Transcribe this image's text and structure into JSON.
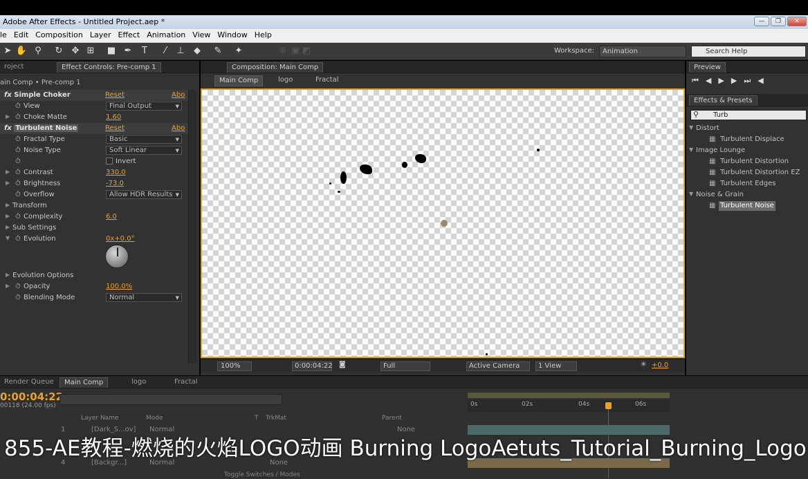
{
  "window": {
    "title": "Adobe After Effects - Untitled Project.aep *",
    "buttons": [
      "—",
      "❐",
      "✕"
    ]
  },
  "menu": [
    "le",
    "Edit",
    "Composition",
    "Layer",
    "Effect",
    "Animation",
    "View",
    "Window",
    "Help"
  ],
  "toolbar": {
    "workspace_label": "Workspace:",
    "workspace_value": "Animation",
    "search_help": "Search Help"
  },
  "left_panel": {
    "tabs": [
      "roject",
      "Effect Controls: Pre-comp 1"
    ],
    "breadcrumb": "ain Comp • Pre-comp 1",
    "effects": [
      {
        "kind": "head",
        "label": "Simple Choker",
        "reset": "Reset",
        "about": "Abo"
      },
      {
        "kind": "drop",
        "label": "View",
        "value": "Final Output"
      },
      {
        "kind": "val",
        "label": "Choke Matte",
        "value": "1.60"
      },
      {
        "kind": "head",
        "label": "Turbulent Noise",
        "reset": "Reset",
        "about": "Abo"
      },
      {
        "kind": "drop",
        "label": "Fractal Type",
        "value": "Basic"
      },
      {
        "kind": "drop",
        "label": "Noise Type",
        "value": "Soft Linear"
      },
      {
        "kind": "check",
        "label": "",
        "value": "Invert"
      },
      {
        "kind": "val",
        "label": "Contrast",
        "value": "330.0"
      },
      {
        "kind": "val",
        "label": "Brightness",
        "value": "-73.0"
      },
      {
        "kind": "drop",
        "label": "Overflow",
        "value": "Allow HDR Results"
      },
      {
        "kind": "group",
        "label": "Transform"
      },
      {
        "kind": "val",
        "label": "Complexity",
        "value": "6.0"
      },
      {
        "kind": "group",
        "label": "Sub Settings"
      },
      {
        "kind": "val",
        "label": "Evolution",
        "value": "0x+0.0°"
      },
      {
        "kind": "group",
        "label": "Evolution Options"
      },
      {
        "kind": "val",
        "label": "Opacity",
        "value": "100.0%"
      },
      {
        "kind": "drop",
        "label": "Blending Mode",
        "value": "Normal"
      }
    ]
  },
  "comp_panel": {
    "tab": "Composition: Main Comp",
    "nav": [
      "Main Comp",
      "logo",
      "Fractal"
    ],
    "bottom": {
      "zoom": "100%",
      "timecode": "0:00:04:22",
      "resolution": "Full",
      "camera": "Active Camera",
      "views": "1 View",
      "exposure": "+0.0"
    }
  },
  "right_panel": {
    "preview_tab": "Preview",
    "effects_tab": "Effects & Presets",
    "search_value": "Turb",
    "tree": [
      {
        "level": 0,
        "label": "Distort"
      },
      {
        "level": 1,
        "label": "Turbulent Displace"
      },
      {
        "level": 0,
        "label": "Image Lounge"
      },
      {
        "level": 1,
        "label": "Turbulent Distortion"
      },
      {
        "level": 1,
        "label": "Turbulent Distortion EZ"
      },
      {
        "level": 1,
        "label": "Turbulent Edges"
      },
      {
        "level": 0,
        "label": "Noise & Grain"
      },
      {
        "level": 1,
        "label": "Turbulent Noise",
        "selected": true
      }
    ]
  },
  "timeline": {
    "tabs": [
      "Render Queue",
      "Main Comp",
      "logo",
      "Fractal"
    ],
    "timecode": "0:00:04:22",
    "frame": "00118 (24.00 fps)",
    "col_headers": [
      "Layer Name",
      "Mode",
      "T",
      "TrkMat",
      "Parent"
    ],
    "ruler": [
      "0s",
      "02s",
      "04s",
      "06s"
    ],
    "layers": [
      {
        "num": "1",
        "name": "[Dark_S...ov]",
        "mode": "Normal",
        "parent": "None"
      },
      {
        "num": "4",
        "name": "[Backgr...]",
        "mode": "Normal",
        "parent": "None"
      }
    ],
    "toggle_label": "Toggle Switches / Modes"
  },
  "caption": "855-AE教程-燃烧的火焰LOGO动画 Burning LogoAetuts_Tutorial_Burning_Logo"
}
